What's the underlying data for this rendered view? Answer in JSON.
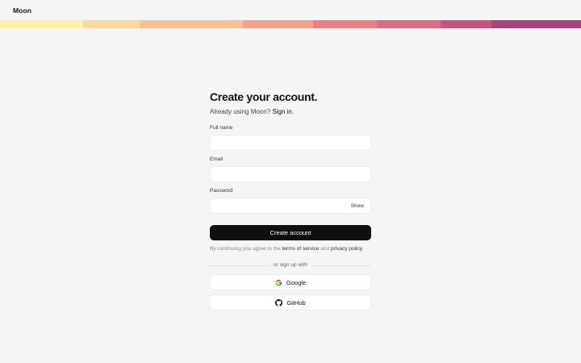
{
  "app": {
    "brand": "Moon"
  },
  "stripe_colors": [
    "#fdf0ad",
    "#fbd8a0",
    "#f7c196",
    "#f2a38d",
    "#ea8085",
    "#df6a86",
    "#cd4f7f",
    "#a54482"
  ],
  "form": {
    "title": "Create your account.",
    "subtitle_prefix": "Already using Moon?",
    "signin_link": "Sign in",
    "subtitle_suffix": ".",
    "fullname_label": "Full name",
    "fullname_value": "",
    "email_label": "Email",
    "email_value": "",
    "password_label": "Password",
    "password_value": "",
    "show_toggle": "Show",
    "submit_label": "Create account",
    "terms_prefix": "By continuing you agree to the",
    "terms_link": "terms of service",
    "terms_mid": "and",
    "privacy_link": "privacy policy",
    "terms_suffix": ".",
    "divider_text": "or sign up with",
    "google_label": "Google",
    "github_label": "GitHub"
  },
  "icons": {
    "google": "google-icon",
    "github": "github-icon"
  }
}
